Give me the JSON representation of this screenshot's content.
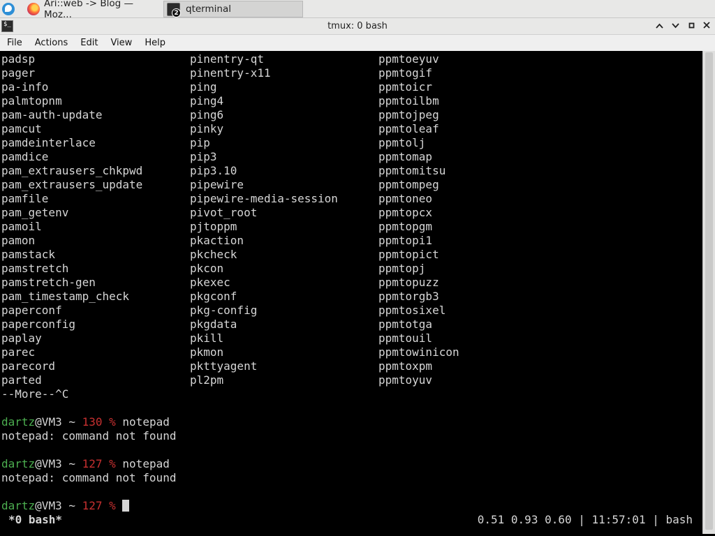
{
  "taskbar": {
    "tasks": [
      {
        "label": "Ari::web -> Blog — Moz..."
      },
      {
        "label": "qterminal",
        "badge": "2"
      }
    ]
  },
  "window": {
    "title": "tmux: 0 bash"
  },
  "menubar": {
    "items": [
      "File",
      "Actions",
      "Edit",
      "View",
      "Help"
    ]
  },
  "terminal": {
    "listing": {
      "col1": [
        "padsp",
        "pager",
        "pa-info",
        "palmtopnm",
        "pam-auth-update",
        "pamcut",
        "pamdeinterlace",
        "pamdice",
        "pam_extrausers_chkpwd",
        "pam_extrausers_update",
        "pamfile",
        "pam_getenv",
        "pamoil",
        "pamon",
        "pamstack",
        "pamstretch",
        "pamstretch-gen",
        "pam_timestamp_check",
        "paperconf",
        "paperconfig",
        "paplay",
        "parec",
        "parecord",
        "parted"
      ],
      "col2": [
        "pinentry-qt",
        "pinentry-x11",
        "ping",
        "ping4",
        "ping6",
        "pinky",
        "pip",
        "pip3",
        "pip3.10",
        "pipewire",
        "pipewire-media-session",
        "pivot_root",
        "pjtoppm",
        "pkaction",
        "pkcheck",
        "pkcon",
        "pkexec",
        "pkgconf",
        "pkg-config",
        "pkgdata",
        "pkill",
        "pkmon",
        "pkttyagent",
        "pl2pm"
      ],
      "col3": [
        "ppmtoeyuv",
        "ppmtogif",
        "ppmtoicr",
        "ppmtoilbm",
        "ppmtojpeg",
        "ppmtoleaf",
        "ppmtolj",
        "ppmtomap",
        "ppmtomitsu",
        "ppmtompeg",
        "ppmtoneo",
        "ppmtopcx",
        "ppmtopgm",
        "ppmtopi1",
        "ppmtopict",
        "ppmtopj",
        "ppmtopuzz",
        "ppmtorgb3",
        "ppmtosixel",
        "ppmtotga",
        "ppmtouil",
        "ppmtowinicon",
        "ppmtoxpm",
        "ppmtoyuv"
      ]
    },
    "more_line": "--More--^C",
    "prompt_user": "dartz",
    "prompt_host": "@VM3 ~ ",
    "sessions": [
      {
        "code": "130 %",
        "command": " notepad",
        "output": "notepad: command not found"
      },
      {
        "code": "127 %",
        "command": " notepad",
        "output": "notepad: command not found"
      }
    ],
    "current_prompt_code": "127 %"
  },
  "tmux_status": {
    "window": "*0 bash*",
    "right": "0.51 0.93 0.60 | 11:57:01 | bash"
  },
  "colors": {
    "prompt_user": "#4caf50",
    "prompt_code": "#c73030",
    "text": "#d6d6d6",
    "background": "#000000"
  }
}
